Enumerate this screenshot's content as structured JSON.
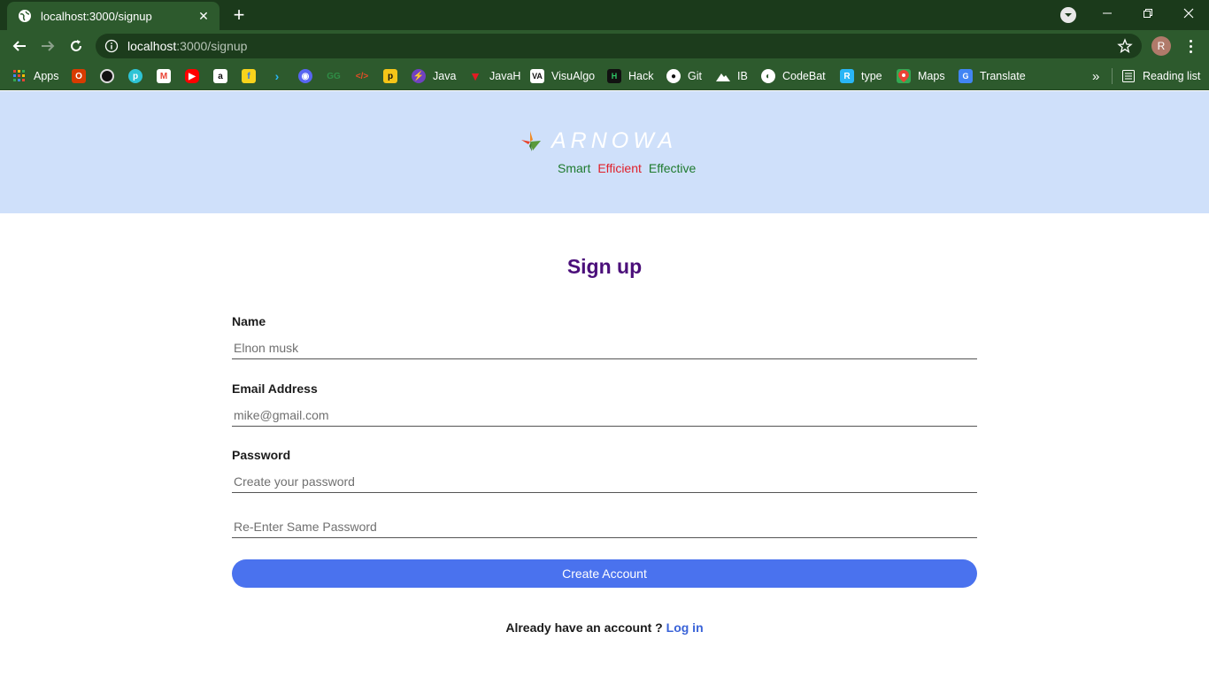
{
  "browser": {
    "tab_title": "localhost:3000/signup",
    "url_host": "localhost",
    "url_path": ":3000/signup",
    "profile_initial": "R",
    "bookmarks": [
      {
        "label": "Apps",
        "icon": "apps-grid-icon"
      },
      {
        "label": "",
        "icon": "office-icon"
      },
      {
        "label": "",
        "icon": "speedometer-icon"
      },
      {
        "label": "",
        "icon": "tp-link-icon"
      },
      {
        "label": "",
        "icon": "gmail-icon"
      },
      {
        "label": "",
        "icon": "youtube-icon"
      },
      {
        "label": "",
        "icon": "amazon-icon"
      },
      {
        "label": "",
        "icon": "flipkart-icon"
      },
      {
        "label": "",
        "icon": "arrow-app-icon"
      },
      {
        "label": "",
        "icon": "discord-icon"
      },
      {
        "label": "",
        "icon": "geeksforgeeks-icon"
      },
      {
        "label": "",
        "icon": "code-tags-icon"
      },
      {
        "label": "",
        "icon": "p-app-icon"
      },
      {
        "label": "Java",
        "icon": "bolt-icon"
      },
      {
        "label": "JavaH",
        "icon": "javah-icon"
      },
      {
        "label": "VisuAlgo",
        "icon": "visualgo-icon"
      },
      {
        "label": "Hack",
        "icon": "hackerrank-icon"
      },
      {
        "label": "Git",
        "icon": "github-icon"
      },
      {
        "label": "IB",
        "icon": "mountain-icon"
      },
      {
        "label": "CodeBat",
        "icon": "globe-icon"
      },
      {
        "label": "type",
        "icon": "type-icon"
      },
      {
        "label": "Maps",
        "icon": "maps-icon"
      },
      {
        "label": "Translate",
        "icon": "translate-icon"
      }
    ],
    "more_bookmarks": "»",
    "reading_list": "Reading list"
  },
  "header": {
    "brand": "ARNOWA",
    "tagline": {
      "smart": "Smart",
      "efficient": "Efficient",
      "effective": "Effective"
    }
  },
  "form": {
    "title": "Sign up",
    "name_label": "Name",
    "name_placeholder": "Elnon musk",
    "email_label": "Email Address",
    "email_placeholder": "mike@gmail.com",
    "password_label": "Password",
    "password_placeholder": "Create your password",
    "confirm_placeholder": "Re-Enter Same Password",
    "submit_label": "Create Account",
    "login_prompt": "Already have an account ?",
    "login_link": "Log in"
  },
  "colors": {
    "chrome_dark": "#1b3a1b",
    "chrome": "#2d5a2d",
    "hero_bg": "#cfe0fa",
    "title": "#4b0f7a",
    "button": "#4a72ee",
    "link": "#3a63d8",
    "tag_green": "#1e7a2e",
    "tag_red": "#e0202a"
  }
}
